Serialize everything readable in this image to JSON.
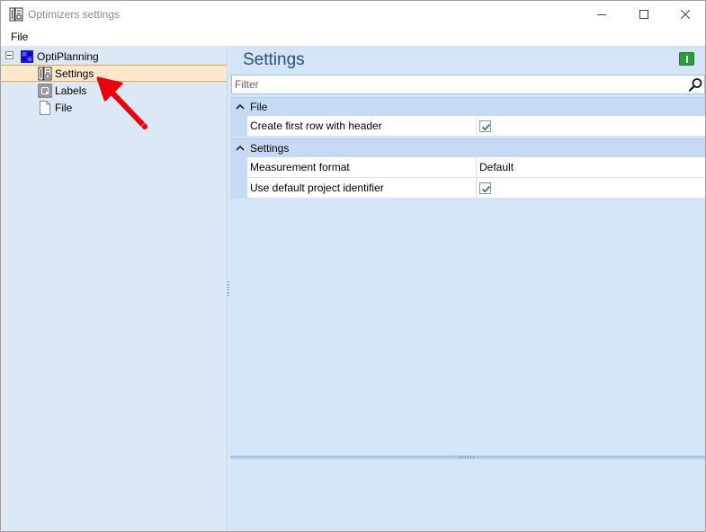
{
  "window": {
    "title": "Optimizers settings",
    "controls": {
      "minimize": "minimize-icon",
      "maximize": "maximize-icon",
      "close": "close-icon"
    }
  },
  "menu": {
    "items": [
      {
        "label": "File"
      }
    ]
  },
  "tree": {
    "root": {
      "label": "OptiPlanning",
      "icon": "optiplanning-icon",
      "expanded": true
    },
    "children": [
      {
        "label": "Settings",
        "icon": "settings-doc-icon",
        "selected": true
      },
      {
        "label": "Labels",
        "icon": "labels-icon"
      },
      {
        "label": "File",
        "icon": "file-icon"
      }
    ]
  },
  "settings_panel": {
    "title": "Settings",
    "filter": {
      "placeholder": "Filter",
      "value": ""
    },
    "groups": [
      {
        "label": "File",
        "rows": [
          {
            "name": "Create first row with header",
            "value": true
          }
        ]
      },
      {
        "label": "Settings",
        "rows": [
          {
            "name": "Measurement format",
            "value": "Default"
          },
          {
            "name": "Use default project identifier",
            "value": true
          }
        ]
      }
    ]
  },
  "colors": {
    "selection": "#fde8cc",
    "panel_background": "#d5e5f8",
    "group_header": "#c6dbf3",
    "title_text": "#2a4f7c",
    "checkmark": "#2d8a3c",
    "annotation_arrow": "#e8000d"
  }
}
